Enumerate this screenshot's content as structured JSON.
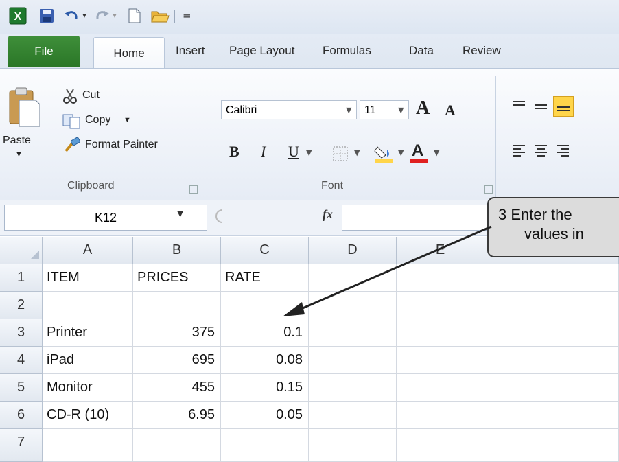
{
  "titlebar": {
    "qat_separator_glyph": "|",
    "qat_menu_glyph": "="
  },
  "tabs": {
    "file": "File",
    "home": "Home",
    "insert": "Insert",
    "page_layout": "Page Layout",
    "formulas": "Formulas",
    "data": "Data",
    "review": "Review"
  },
  "ribbon": {
    "clipboard": {
      "paste": "Paste",
      "cut": "Cut",
      "copy": "Copy",
      "format_painter": "Format Painter",
      "group_label": "Clipboard"
    },
    "font": {
      "font_name": "Calibri",
      "font_size": "11",
      "group_label": "Font",
      "grow_glyph": "A",
      "shrink_glyph": "A",
      "bold_glyph": "B",
      "italic_glyph": "I",
      "underline_glyph": "U",
      "fill_glyph": "A"
    }
  },
  "formula_bar": {
    "name_box": "K12",
    "fx_label": "fx",
    "formula": ""
  },
  "sheet": {
    "corner": "",
    "columns": [
      "A",
      "B",
      "C",
      "D",
      "E"
    ],
    "rows": [
      {
        "n": "1",
        "a": "ITEM",
        "b": "PRICES",
        "c": "RATE"
      },
      {
        "n": "2",
        "a": "",
        "b": "",
        "c": ""
      },
      {
        "n": "3",
        "a": "Printer",
        "b": "375",
        "c": "0.1"
      },
      {
        "n": "4",
        "a": "iPad",
        "b": "695",
        "c": "0.08"
      },
      {
        "n": "5",
        "a": "Monitor",
        "b": "455",
        "c": "0.15"
      },
      {
        "n": "6",
        "a": "CD-R (10)",
        "b": "6.95",
        "c": "0.05"
      },
      {
        "n": "7",
        "a": "",
        "b": "",
        "c": ""
      }
    ]
  },
  "callout": {
    "line1": "3 Enter the",
    "line2": "values in"
  },
  "colors": {
    "file_tab": "#2a7627",
    "callout_fill": "#dcdcdc",
    "grid_line": "#d4d9e1",
    "highlight_yellow": "#ffd54a",
    "font_red": "#e02020"
  }
}
